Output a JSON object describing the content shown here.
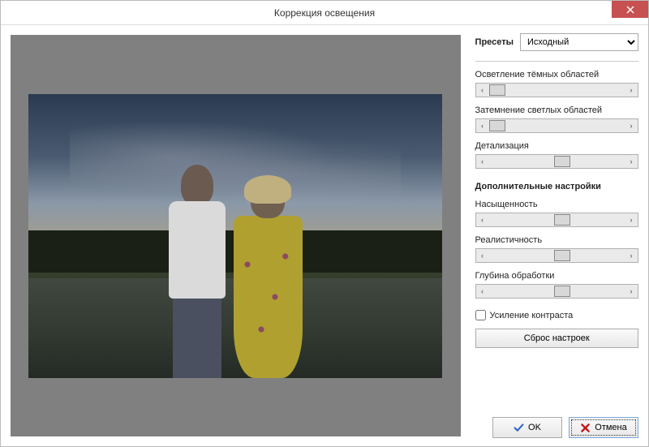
{
  "window": {
    "title": "Коррекция освещения"
  },
  "preset": {
    "label": "Пресеты",
    "selected": "Исходный"
  },
  "sliders": {
    "lighten_dark": {
      "label": "Осветление тёмных областей",
      "pos": 5
    },
    "darken_light": {
      "label": "Затемнение светлых областей",
      "pos": 0
    },
    "detail": {
      "label": "Детализация",
      "pos": 48
    }
  },
  "advanced": {
    "title": "Дополнительные настройки",
    "saturation": {
      "label": "Насыщенность",
      "pos": 48
    },
    "realism": {
      "label": "Реалистичность",
      "pos": 48
    },
    "depth": {
      "label": "Глубина обработки",
      "pos": 48
    }
  },
  "checkbox": {
    "contrast_boost": "Усиление контраста",
    "checked": false
  },
  "buttons": {
    "reset": "Сброс настроек",
    "ok": "OK",
    "cancel": "Отмена"
  }
}
